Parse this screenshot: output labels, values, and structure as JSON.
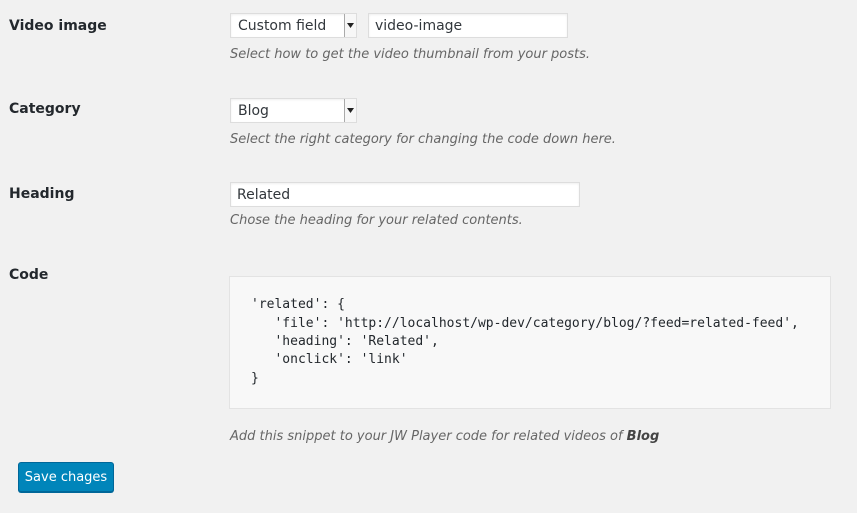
{
  "fields": {
    "video_image": {
      "label": "Video image",
      "source_value": "Custom field",
      "custom_field_value": "video-image",
      "description": "Select how to get the video thumbnail from your posts."
    },
    "category": {
      "label": "Category",
      "value": "Blog",
      "description": "Select the right category for changing the code down here."
    },
    "heading": {
      "label": "Heading",
      "value": "Related",
      "description": "Chose the heading for your related contents."
    },
    "code": {
      "label": "Code",
      "lines": [
        "'related': {",
        "   'file': 'http://localhost/wp-dev/category/blog/?feed=related-feed',",
        "   'heading': 'Related',",
        "   'onclick': 'link'",
        "}"
      ],
      "description_prefix": "Add this snippet to your JW Player code for related videos of ",
      "description_category": "Blog"
    }
  },
  "save_button": {
    "label": "Save chages"
  },
  "icons": {
    "select_arrow": "chevron-down-icon"
  }
}
